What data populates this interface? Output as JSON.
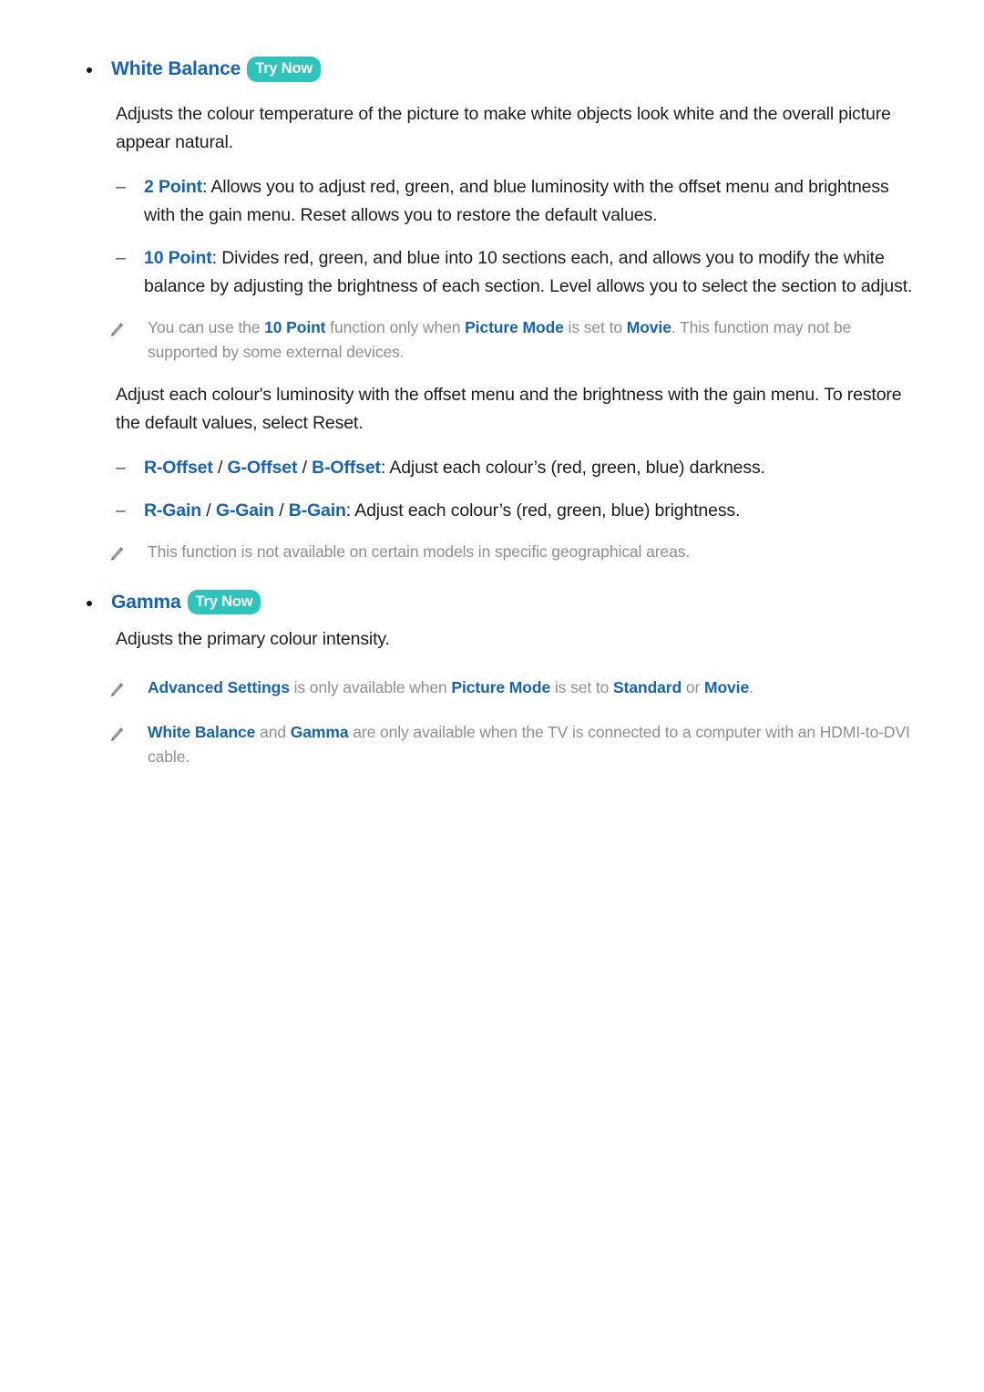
{
  "document": {
    "sections": [
      {
        "id": "white-balance",
        "heading": "White Balance",
        "badge": "Try Now",
        "paragraph": "Adjusts the colour temperature of the picture to make white objects look white and the overall picture appear natural.",
        "items": [
          {
            "term": "2 Point",
            "text": ": Allows you to adjust red, green, and blue luminosity with the offset menu and brightness with the gain menu. Reset allows you to restore the default values."
          },
          {
            "term": "10 Point",
            "text": ": Divides red, green, and blue into 10 sections each, and allows you to modify the white balance by adjusting the brightness of each section. Level allows you to select the section to adjust."
          }
        ],
        "note_1": {
          "part_1": "You can use the ",
          "term_1": "10 Point",
          "part_2": " function only when ",
          "term_2": "Picture Mode",
          "part_3": " is set to ",
          "term_3": "Movie",
          "part_4": ". This function may not be supported by some external devices."
        },
        "paragraph_2": "Adjust each colour's luminosity with the offset menu and the brightness with the gain menu. To restore the default values, select Reset.",
        "offset_item": {
          "term_1": "R-Offset",
          "sep_1": " / ",
          "term_2": "G-Offset",
          "sep_2": " / ",
          "term_3": "B-Offset",
          "text": ": Adjust each colour’s (red, green, blue) darkness."
        },
        "gain_item": {
          "term_1": "R-Gain",
          "sep_1": " / ",
          "term_2": "G-Gain",
          "sep_2": " / ",
          "term_3": "B-Gain",
          "text": ": Adjust each colour’s (red, green, blue) brightness."
        },
        "note_2": "This function is not available on certain models in specific geographical areas."
      },
      {
        "id": "gamma",
        "heading": "Gamma",
        "badge": "Try Now",
        "paragraph": "Adjusts the primary colour intensity.",
        "note_1": {
          "term_1": "Advanced Settings",
          "part_1": " is only available when ",
          "term_2": "Picture Mode",
          "part_2": " is set to ",
          "term_3": "Standard",
          "part_3": " or ",
          "term_4": "Movie",
          "part_4": "."
        },
        "note_2": {
          "term_1": "White Balance",
          "part_1": " and ",
          "term_2": "Gamma",
          "part_2": " are only available when the TV is connected to a computer with an HDMI-to-DVI cable."
        }
      }
    ]
  },
  "icons": {
    "note_icon": "pencil-icon",
    "bullet_icon": "bullet-dot-icon",
    "dash_icon": "en-dash-icon"
  },
  "colors": {
    "heading_blue": "#1663b5",
    "badge_teal": "#2ec4bb",
    "body_text": "#1d1d1d",
    "note_text": "#8e8e8e",
    "page_background": "#ffffff"
  },
  "glyphs": {
    "dash": "–"
  }
}
